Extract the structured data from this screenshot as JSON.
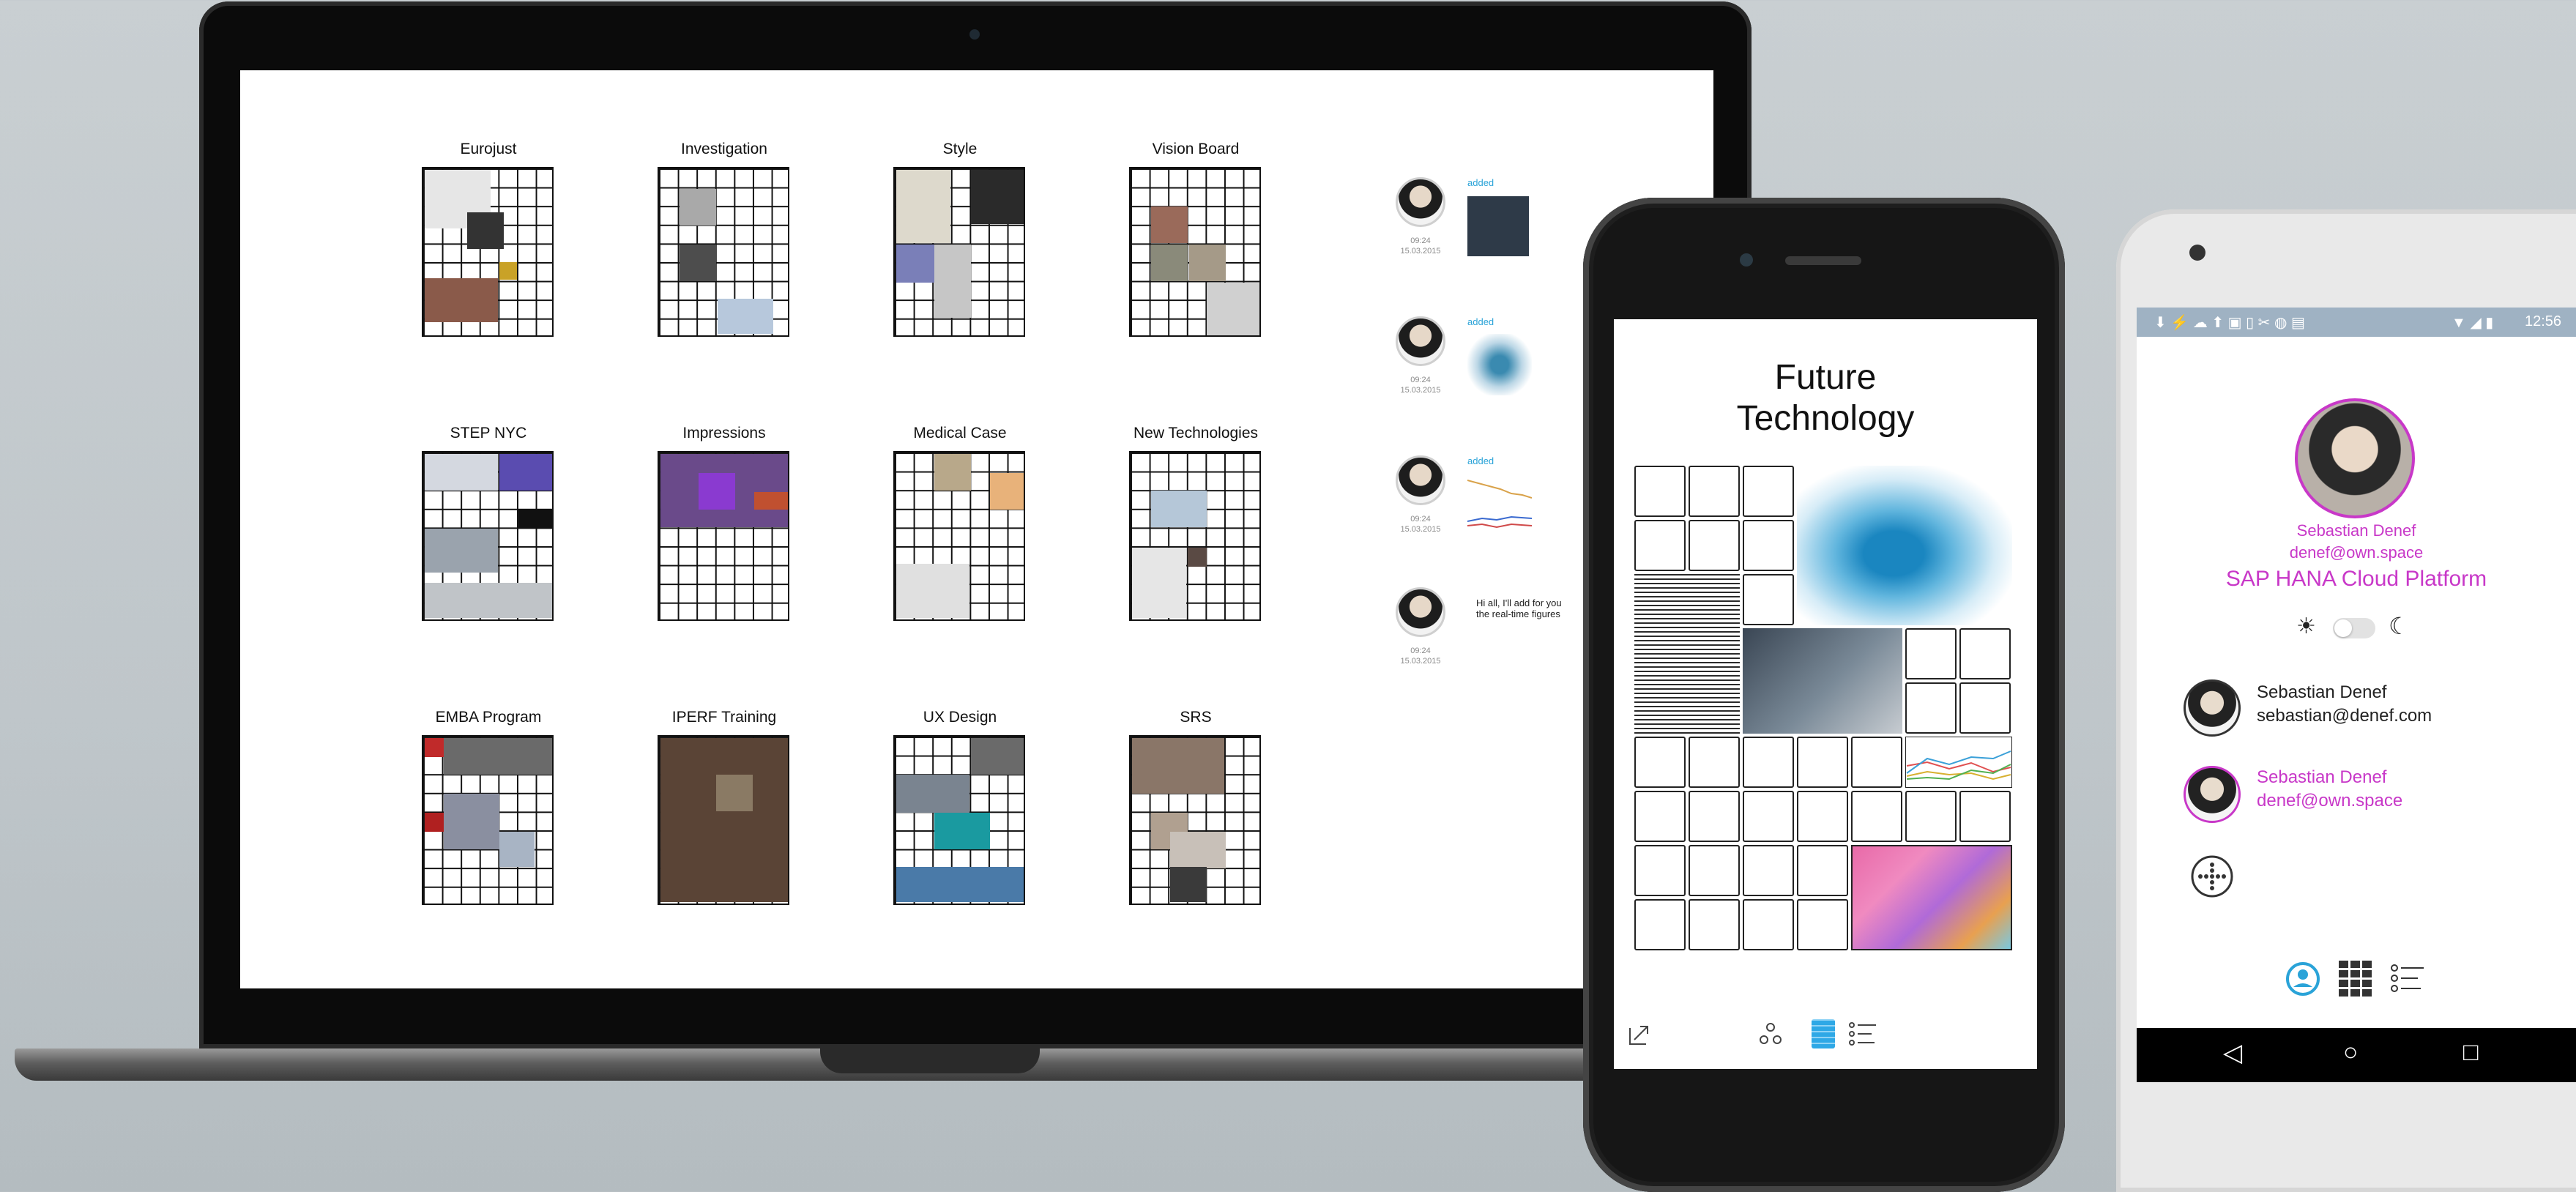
{
  "laptop": {
    "boards": [
      {
        "title": "Eurojust"
      },
      {
        "title": "Investigation"
      },
      {
        "title": "Style"
      },
      {
        "title": "Vision Board"
      },
      {
        "title": "STEP NYC"
      },
      {
        "title": "Impressions"
      },
      {
        "title": "Medical Case"
      },
      {
        "title": "New Technologies"
      },
      {
        "title": "EMBA Program"
      },
      {
        "title": "IPERF Training"
      },
      {
        "title": "UX Design"
      },
      {
        "title": "SRS"
      }
    ],
    "feed": [
      {
        "action": "added",
        "time": "09:24",
        "date": "15.03.2015"
      },
      {
        "action": "added",
        "time": "09:24",
        "date": "15.03.2015"
      },
      {
        "action": "added",
        "time": "09:24",
        "date": "15.03.2015"
      },
      {
        "message": "Hi all, I'll add for you the real-time figures",
        "time": "09:24",
        "date": "15.03.2015"
      }
    ]
  },
  "iphone": {
    "title_line1": "Future",
    "title_line2": "Technology",
    "toolbar": {
      "icons": [
        "share-icon",
        "network-icon",
        "grid-icon",
        "list-icon"
      ]
    }
  },
  "android": {
    "status_time": "12:56",
    "profile": {
      "name": "Sebastian Denef",
      "email": "denef@own.space",
      "platform": "SAP HANA Cloud Platform"
    },
    "theme_toggle": {
      "light_icon": "☀",
      "dark_icon": "☾"
    },
    "accounts": [
      {
        "name": "Sebastian Denef",
        "email": "sebastian@denef.com"
      },
      {
        "name": "Sebastian Denef",
        "email": "denef@own.space"
      }
    ],
    "colors": {
      "accent": "#c838c8",
      "link": "#2aa3d8"
    }
  }
}
